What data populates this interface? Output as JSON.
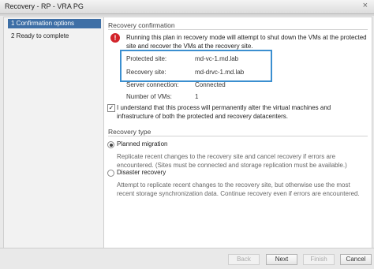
{
  "window": {
    "title": "Recovery - RP - VRA PG",
    "close_glyph": "×"
  },
  "sidebar": {
    "steps": [
      {
        "label": "1  Confirmation options",
        "active": true
      },
      {
        "label": "2  Ready to complete",
        "active": false
      }
    ]
  },
  "confirmation": {
    "title": "Recovery confirmation",
    "warning_icon": "!",
    "warning_text": "Running this plan in recovery mode will attempt to shut down the VMs at the protected site and recover the VMs at the recovery site.",
    "details": [
      {
        "label": "Protected site:",
        "value": "md-vc-1.md.lab"
      },
      {
        "label": "Recovery site:",
        "value": "md-drvc-1.md.lab"
      },
      {
        "label": "Server connection:",
        "value": "Connected"
      },
      {
        "label": "Number of VMs:",
        "value": "1"
      }
    ],
    "acknowledge": {
      "checked": true,
      "mark": "✓",
      "text": "I understand that this process will permanently alter the virtual machines and infrastructure of both the protected and recovery datacenters."
    }
  },
  "recovery_type": {
    "title": "Recovery type",
    "options": [
      {
        "label": "Planned migration",
        "selected": true,
        "description": "Replicate recent changes to the recovery site and cancel recovery if errors are encountered. (Sites must be connected and storage replication must be available.)"
      },
      {
        "label": "Disaster recovery",
        "selected": false,
        "description": "Attempt to replicate recent changes to the recovery site, but otherwise use the most recent storage synchronization data. Continue recovery even if errors are encountered."
      }
    ]
  },
  "buttons": {
    "back": "Back",
    "next": "Next",
    "finish": "Finish",
    "cancel": "Cancel"
  },
  "colors": {
    "accent": "#3e6fa6",
    "highlight_border": "#3b8fd0",
    "warning": "#d2232a"
  }
}
